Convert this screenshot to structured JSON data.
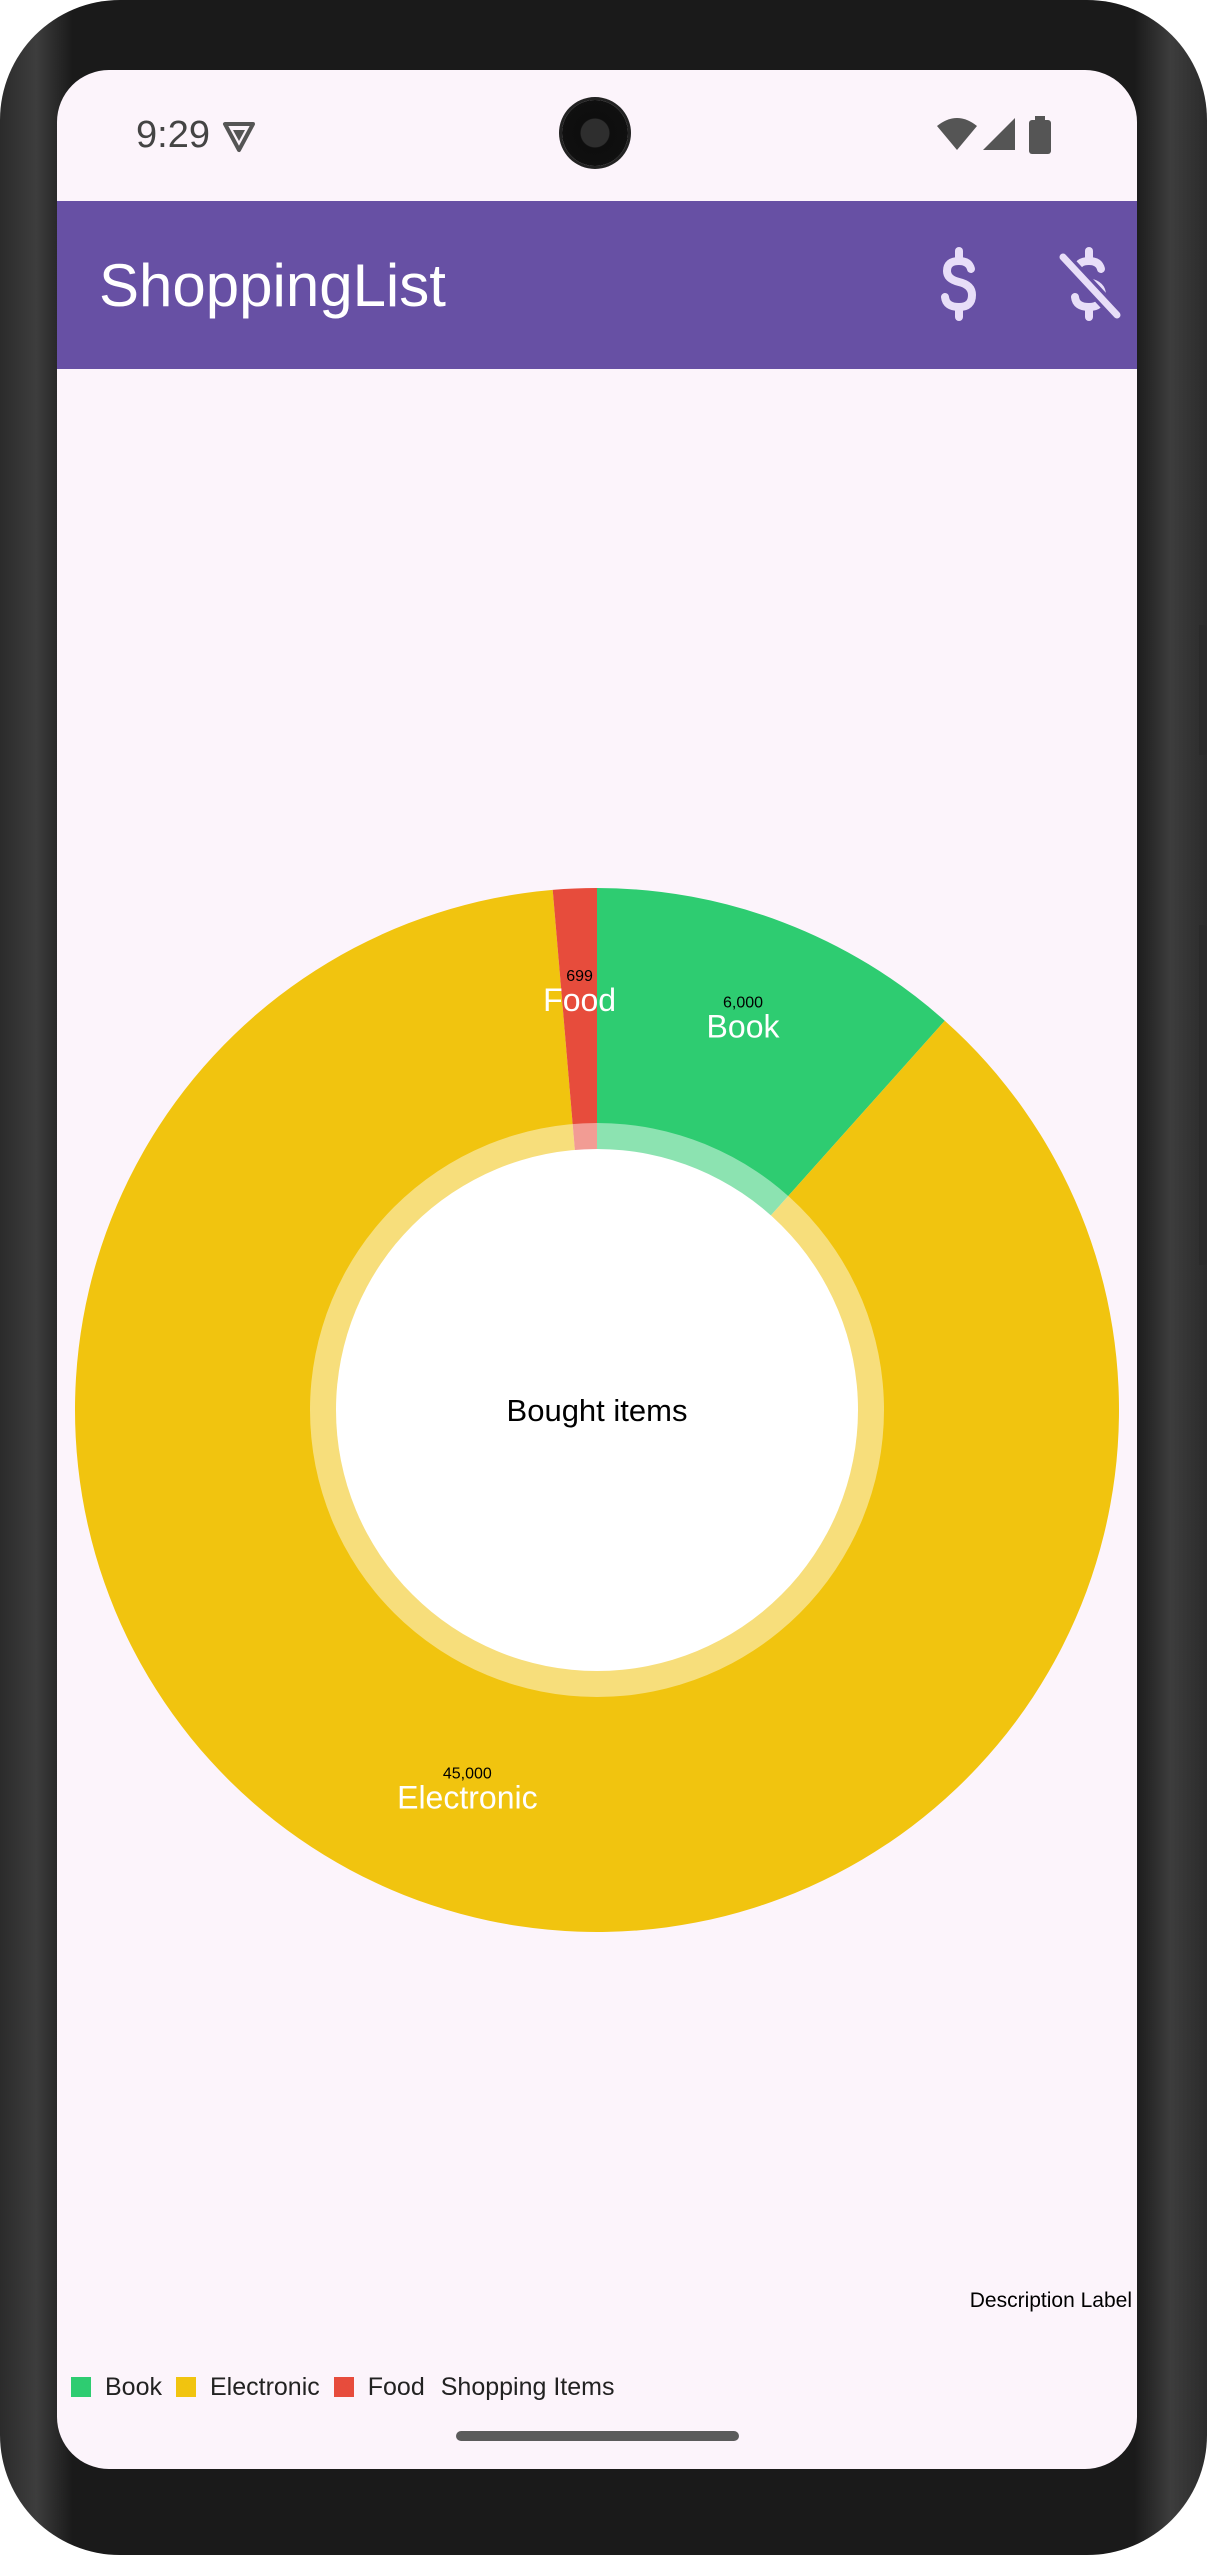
{
  "status_bar": {
    "time": "9:29"
  },
  "app_bar": {
    "title": "ShoppingList",
    "background": "#6750a4",
    "actions": [
      {
        "icon": "dollar-icon"
      },
      {
        "icon": "no-dollar-icon"
      }
    ]
  },
  "chart_data": {
    "type": "pie",
    "center_text": "Bought items",
    "description": "Description Label",
    "legend_title": "Shopping Items",
    "legend_position": "bottom-left",
    "hole": true,
    "slices": [
      {
        "label": "Book",
        "value": 6000,
        "value_label": "6,000",
        "color": "#2ecc71"
      },
      {
        "label": "Electronic",
        "value": 45000,
        "value_label": "45,000",
        "color": "#f1c40f"
      },
      {
        "label": "Food",
        "value": 699,
        "value_label": "699",
        "color": "#e74c3c"
      }
    ]
  }
}
